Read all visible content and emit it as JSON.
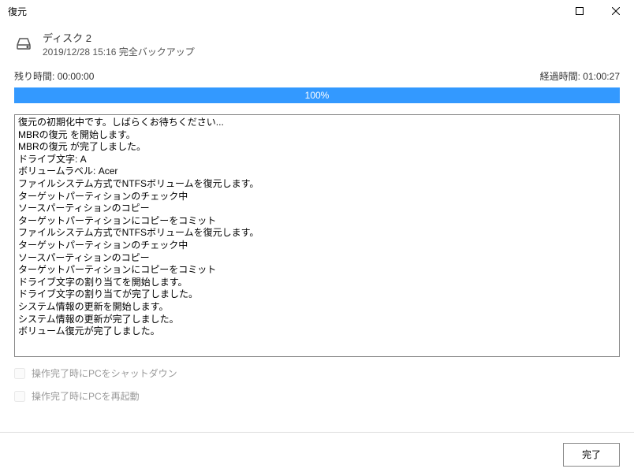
{
  "titlebar": {
    "title": "復元"
  },
  "header": {
    "disk_title": "ディスク 2",
    "backup_info": "2019/12/28 15:16 完全バックアップ"
  },
  "time": {
    "remaining_label": "残り時間:",
    "remaining_value": "00:00:00",
    "elapsed_label": "経過時間:",
    "elapsed_value": "01:00:27"
  },
  "progress": {
    "percent_text": "100%"
  },
  "log": {
    "text": "復元の初期化中です。しばらくお待ちください...\nMBRの復元 を開始します。\nMBRの復元 が完了しました。\nドライブ文字: A\nボリュームラベル: Acer\nファイルシステム方式でNTFSボリュームを復元します。\nターゲットパーティションのチェック中\nソースパーティションのコピー\nターゲットパーティションにコピーをコミット\nファイルシステム方式でNTFSボリュームを復元します。\nターゲットパーティションのチェック中\nソースパーティションのコピー\nターゲットパーティションにコピーをコミット\nドライブ文字の割り当てを開始します。\nドライブ文字の割り当てが完了しました。\nシステム情報の更新を開始します。\nシステム情報の更新が完了しました。\nボリューム復元が完了しました。"
  },
  "options": {
    "shutdown_label": "操作完了時にPCをシャットダウン",
    "restart_label": "操作完了時にPCを再起動"
  },
  "footer": {
    "done_label": "完了"
  }
}
